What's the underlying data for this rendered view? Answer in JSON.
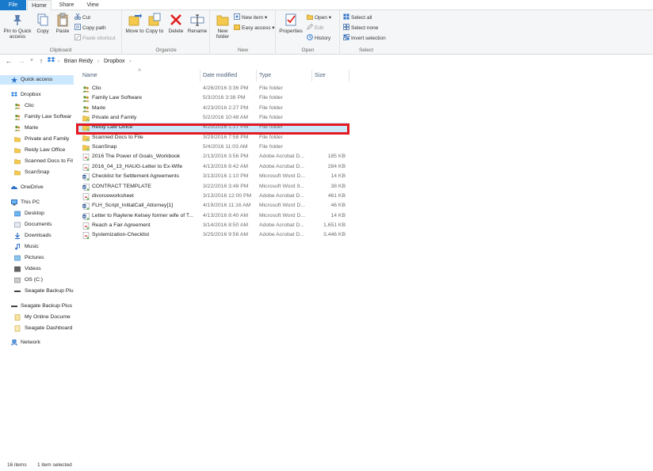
{
  "tabs": [
    {
      "label": "File"
    },
    {
      "label": "Home"
    },
    {
      "label": "Share"
    },
    {
      "label": "View"
    }
  ],
  "ribbon": {
    "clipboard": {
      "label": "Clipboard",
      "pin": "Pin to Quick access",
      "copy": "Copy",
      "paste": "Paste",
      "cut": "Cut",
      "copy_path": "Copy path",
      "paste_shortcut": "Paste shortcut"
    },
    "organize": {
      "label": "Organize",
      "move_to": "Move to",
      "copy_to": "Copy to",
      "delete": "Delete",
      "rename": "Rename"
    },
    "new": {
      "label": "New",
      "new_folder": "New folder",
      "new_item": "New item",
      "easy_access": "Easy access"
    },
    "open": {
      "label": "Open",
      "properties": "Properties",
      "open": "Open",
      "edit": "Edit",
      "history": "History"
    },
    "select": {
      "label": "Select",
      "select_all": "Select all",
      "select_none": "Select none",
      "invert": "Invert selection"
    }
  },
  "address": {
    "crumbs": [
      "Brian Reidy",
      "Dropbox"
    ]
  },
  "nav": {
    "quick_access": "Quick access",
    "dropbox": "Dropbox",
    "dropbox_children": [
      "Clio",
      "Family Law Softwar",
      "Marie",
      "Private and Family",
      "Reidy Law Office",
      "Scanned Docs to Fil",
      "ScanSnap"
    ],
    "onedrive": "OneDrive",
    "this_pc": "This PC",
    "pc_children": [
      "Desktop",
      "Documents",
      "Downloads",
      "Music",
      "Pictures",
      "Videos",
      "OS (C:)",
      "Seagate Backup Plu"
    ],
    "seagate": "Seagate Backup Plus",
    "seagate_children": [
      "My Online Docume",
      "Seagate Dashboard"
    ],
    "network": "Network"
  },
  "columns": {
    "name": "Name",
    "date": "Date modified",
    "type": "Type",
    "size": "Size"
  },
  "files": [
    {
      "name": "Clio",
      "date": "4/26/2016 3:36 PM",
      "type": "File folder",
      "size": "",
      "icon": "folder-shared-icon"
    },
    {
      "name": "Family Law Software",
      "date": "5/3/2016 3:38 PM",
      "type": "File folder",
      "size": "",
      "icon": "folder-shared-icon"
    },
    {
      "name": "Marie",
      "date": "4/23/2016 2:27 PM",
      "type": "File folder",
      "size": "",
      "icon": "folder-shared-icon"
    },
    {
      "name": "Private and Family",
      "date": "5/2/2016 10:48 AM",
      "type": "File folder",
      "size": "",
      "icon": "folder-icon"
    },
    {
      "name": "Reidy Law Office",
      "date": "4/20/2016 1:17 PM",
      "type": "File folder",
      "size": "",
      "icon": "folder-icon"
    },
    {
      "name": "Scanned Docs to File",
      "date": "3/29/2016 7:58 PM",
      "type": "File folder",
      "size": "",
      "icon": "folder-icon"
    },
    {
      "name": "ScanSnap",
      "date": "5/4/2016 11:03 AM",
      "type": "File folder",
      "size": "",
      "icon": "folder-icon"
    },
    {
      "name": "2016 The Power of Goals_Workbook",
      "date": "2/13/2016 3:56 PM",
      "type": "Adobe Acrobat D...",
      "size": "185 KB",
      "icon": "pdf-icon"
    },
    {
      "name": "2016_04_13_HAUG-Letter to Ex-Wife",
      "date": "4/13/2016 8:42 AM",
      "type": "Adobe Acrobat D...",
      "size": "284 KB",
      "icon": "pdf-icon"
    },
    {
      "name": "Checklist for Settlement Agreements",
      "date": "3/13/2016 1:10 PM",
      "type": "Microsoft Word D...",
      "size": "14 KB",
      "icon": "word-icon"
    },
    {
      "name": "CONTRACT TEMPLATE",
      "date": "3/22/2016 3:48 PM",
      "type": "Microsoft Word 9...",
      "size": "38 KB",
      "icon": "word-icon"
    },
    {
      "name": "divorceworksheet",
      "date": "3/13/2016 12:00 PM",
      "type": "Adobe Acrobat D...",
      "size": "461 KB",
      "icon": "pdf-icon"
    },
    {
      "name": "FLH_Script_InitialCall_Attorney[1]",
      "date": "4/19/2016 11:16 AM",
      "type": "Microsoft Word D...",
      "size": "46 KB",
      "icon": "word-icon"
    },
    {
      "name": "Letter to Raylene Kelsey former wife of T...",
      "date": "4/13/2016 8:40 AM",
      "type": "Microsoft Word D...",
      "size": "14 KB",
      "icon": "word-icon"
    },
    {
      "name": "Reach a Fair Agreement",
      "date": "3/14/2016 8:50 AM",
      "type": "Adobe Acrobat D...",
      "size": "1,651 KB",
      "icon": "pdf-icon"
    },
    {
      "name": "Systemization-Checklist",
      "date": "3/25/2016 9:56 AM",
      "type": "Adobe Acrobat D...",
      "size": "3,446 KB",
      "icon": "pdf-icon"
    }
  ],
  "status": {
    "count": "16 items",
    "selected": "1 item selected"
  },
  "colors": {
    "accent": "#1979ca",
    "selection": "#cce8ff",
    "highlight": "#e5191f",
    "folder": "#f4c94c"
  }
}
